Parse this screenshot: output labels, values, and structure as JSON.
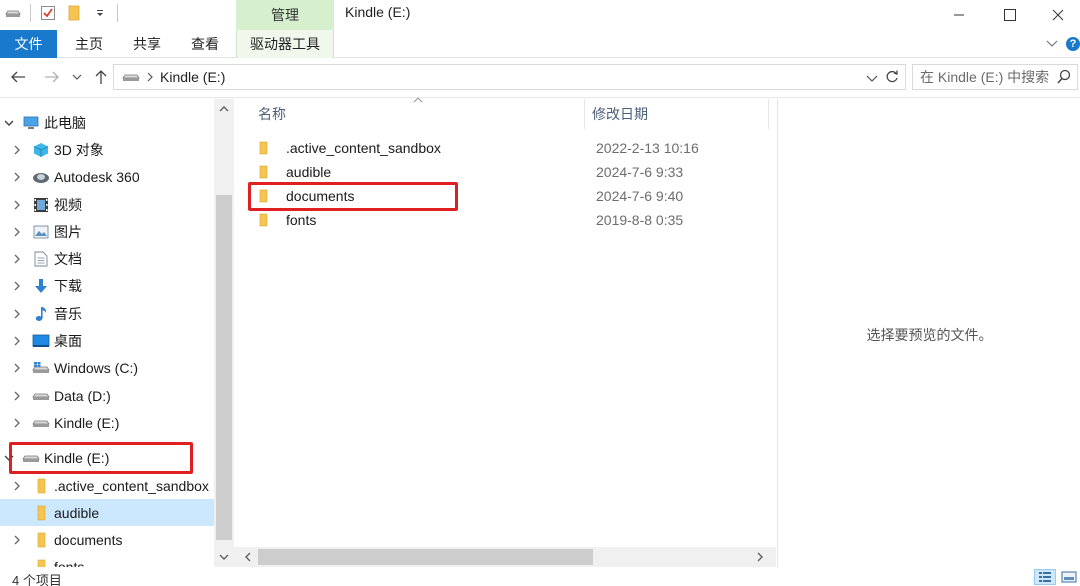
{
  "window": {
    "title": "Kindle (E:)",
    "manage_tab": "管理",
    "help": "?"
  },
  "ribbon": {
    "tabs": [
      "文件",
      "主页",
      "共享",
      "查看",
      "驱动器工具"
    ]
  },
  "address": {
    "path": "Kindle (E:)",
    "search_placeholder": "在 Kindle (E:) 中搜索"
  },
  "nav": {
    "items": [
      {
        "label": "此电脑",
        "icon": "pc-icon"
      },
      {
        "label": "3D 对象",
        "icon": "3d-objects-icon"
      },
      {
        "label": "Autodesk 360",
        "icon": "autodesk-360-icon"
      },
      {
        "label": "视频",
        "icon": "videos-icon"
      },
      {
        "label": "图片",
        "icon": "pictures-icon"
      },
      {
        "label": "文档",
        "icon": "documents-icon"
      },
      {
        "label": "下载",
        "icon": "downloads-icon"
      },
      {
        "label": "音乐",
        "icon": "music-icon"
      },
      {
        "label": "桌面",
        "icon": "desktop-icon"
      },
      {
        "label": "Windows (C:)",
        "icon": "windows-drive-icon"
      },
      {
        "label": "Data (D:)",
        "icon": "drive-icon"
      },
      {
        "label": "Kindle (E:)",
        "icon": "drive-icon"
      },
      {
        "label": "Kindle (E:)",
        "icon": "drive-icon"
      },
      {
        "label": ".active_content_sandbox",
        "icon": "folder-icon"
      },
      {
        "label": "audible",
        "icon": "folder-icon"
      },
      {
        "label": "documents",
        "icon": "folder-icon"
      },
      {
        "label": "fonts",
        "icon": "folder-icon"
      }
    ]
  },
  "files": {
    "columns": {
      "name": "名称",
      "modified": "修改日期"
    },
    "rows": [
      {
        "name": ".active_content_sandbox",
        "date": "2022-2-13 10:16"
      },
      {
        "name": "audible",
        "date": "2024-7-6 9:33"
      },
      {
        "name": "documents",
        "date": "2024-7-6 9:40"
      },
      {
        "name": "fonts",
        "date": "2019-8-8 0:35"
      }
    ]
  },
  "preview": {
    "message": "选择要预览的文件。"
  },
  "status": {
    "count": "4 个项目"
  },
  "colors": {
    "accent": "#1979ca",
    "manage": "#d6efcd",
    "selection": "#cce8ff",
    "highlight": "#e02020",
    "folder": "#f5c451"
  }
}
